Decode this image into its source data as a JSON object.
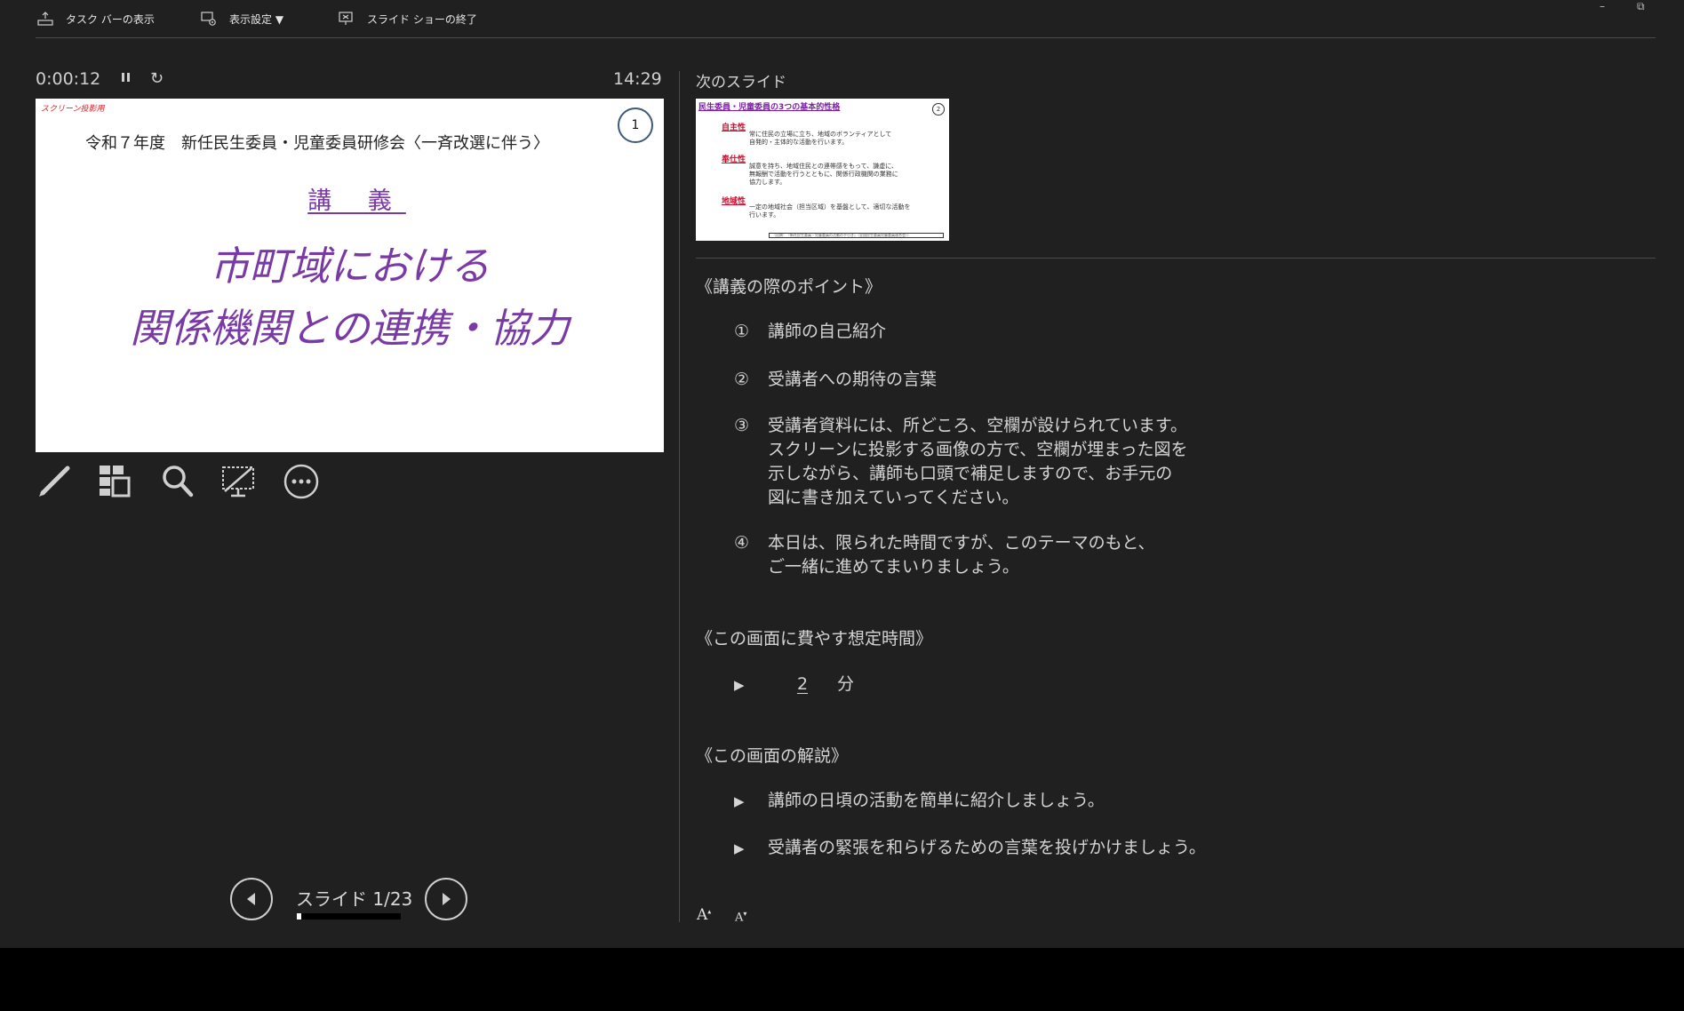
{
  "toolbar": {
    "taskbar_label": "タスク バーの表示",
    "display_settings_label": "表示設定 ▼",
    "end_show_label": "スライド ショーの終了",
    "minimize_glyph": "–",
    "restore_glyph": "⧉"
  },
  "left": {
    "elapsed": "0:00:12",
    "pause_glyph": "⏸",
    "restart_glyph": "↻",
    "clock": "14:29",
    "slide": {
      "note": "スクリーン投影用",
      "number": "1",
      "subtitle": "令和７年度　新任民生委員・児童委員研修会〈一斉改選に伴う〉",
      "lecture": "講 義",
      "title_line1": "市町域における",
      "title_line2": "関係機関との連携・協力"
    },
    "tools": [
      "pen-icon",
      "slides-grid-icon",
      "zoom-icon",
      "black-screen-icon",
      "more-options-icon"
    ],
    "slide_counter": "スライド 1/23",
    "progress_fraction": 0.0435
  },
  "right": {
    "next_label": "次のスライド",
    "thumb": {
      "title": "民生委員・児童委員の3つの基本的性格",
      "number": "2",
      "headings": [
        "自主性",
        "奉仕性",
        "地域性"
      ],
      "bodies": [
        "常に住民の立場に立ち、地域のボランティアとして\n自発的・主体的な活動を行います。",
        "誠意を持ち、地域住民との連帯感をもって、謙虚に、\n無報酬で活動を行うとともに、関係行政機関の業務に\n協力します。",
        "一定の地域社会（担当区域）を基盤として、適切な活動を\n行います。"
      ],
      "footer": "（出典：『新任民生委員・児童委員の活動の手引き』（全国民生委員児童委員連合会））"
    },
    "notes": {
      "heading1": "《講義の際のポイント》",
      "points": [
        {
          "marker": "①",
          "lines": [
            "講師の自己紹介"
          ]
        },
        {
          "marker": "②",
          "lines": [
            "受講者への期待の言葉"
          ]
        },
        {
          "marker": "③",
          "lines": [
            "受講者資料には、所どころ、空欄が設けられています。",
            "スクリーンに投影する画像の方で、空欄が埋まった図を",
            "示しながら、講師も口頭で補足しますので、お手元の",
            "図に書き加えていってください。"
          ]
        },
        {
          "marker": "④",
          "lines": [
            "本日は、限られた時間ですが、このテーマのもと、",
            "ご一緒に進めてまいりましょう。"
          ]
        }
      ],
      "heading2": "《この画面に費やす想定時間》",
      "time_value": "2",
      "time_unit": "分",
      "heading3": "《この画面の解説》",
      "explain": [
        "講師の日頃の活動を簡単に紹介しましょう。",
        "受講者の緊張を和らげるための言葉を投げかけましょう。"
      ],
      "arrow_glyph": "▶"
    },
    "font_up": "A",
    "font_down": "A"
  }
}
